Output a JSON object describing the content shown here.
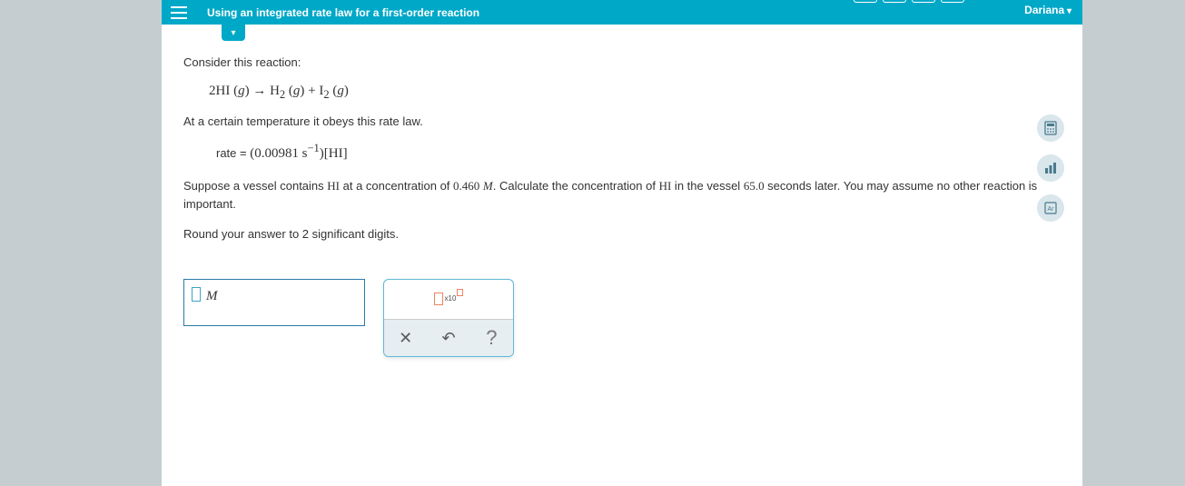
{
  "header": {
    "title": "Using an integrated rate law for a first-order reaction",
    "user": "Dariana"
  },
  "problem": {
    "intro": "Consider this reaction:",
    "equation_html": "2HI (g) → H<sub>2</sub> (g) + I<sub>2</sub> (g)",
    "rate_intro": "At a certain temperature it obeys this rate law.",
    "rate_label": "rate  =",
    "rate_constant": "0.00981",
    "rate_unit_html": "s<sup>−1</sup>",
    "rate_species": "[HI]",
    "question_p1": "Suppose a vessel contains ",
    "species": "HI",
    "question_p2": " at a concentration of ",
    "init_conc": "0.460",
    "conc_unit": "M",
    "question_p3": ". Calculate the concentration of ",
    "question_p4": " in the vessel ",
    "time": "65.0",
    "question_p5": " seconds later. You may assume no other reaction is important.",
    "round_instr": "Round your answer to 2 significant digits."
  },
  "answer": {
    "unit": "M",
    "sci_label": "x10"
  },
  "toolbox": {
    "clear": "✕",
    "undo": "↶",
    "help": "?"
  }
}
